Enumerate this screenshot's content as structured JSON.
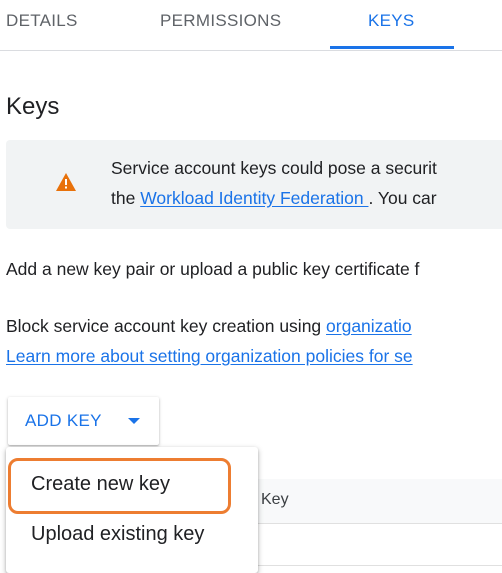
{
  "tabs": [
    {
      "label": "DETAILS"
    },
    {
      "label": "PERMISSIONS"
    },
    {
      "label": "KEYS",
      "active": true
    }
  ],
  "section": {
    "heading": "Keys"
  },
  "banner": {
    "icon": "warning-icon",
    "icon_color": "#e8710a",
    "line1": "Service account keys could pose a securit",
    "line2_prefix": "the ",
    "line2_link": "Workload Identity Federation ",
    "line2_suffix": ". You car"
  },
  "body": {
    "add_text": "Add a new key pair or upload a public key certificate f",
    "block_prefix": "Block service account key creation using ",
    "block_link": "organizatio",
    "learn_more_link": "Learn more about setting organization policies for se"
  },
  "add_key_button": {
    "label": "ADD KEY",
    "icon": "caret-down-icon"
  },
  "menu": {
    "items": [
      {
        "label": "Create new key",
        "highlighted": true
      },
      {
        "label": "Upload existing key"
      }
    ]
  },
  "table": {
    "header_key": "Key"
  },
  "colors": {
    "accent": "#1a73e8",
    "warning": "#e8710a",
    "highlight": "#ed7d31",
    "banner_bg": "#f1f3f4"
  }
}
